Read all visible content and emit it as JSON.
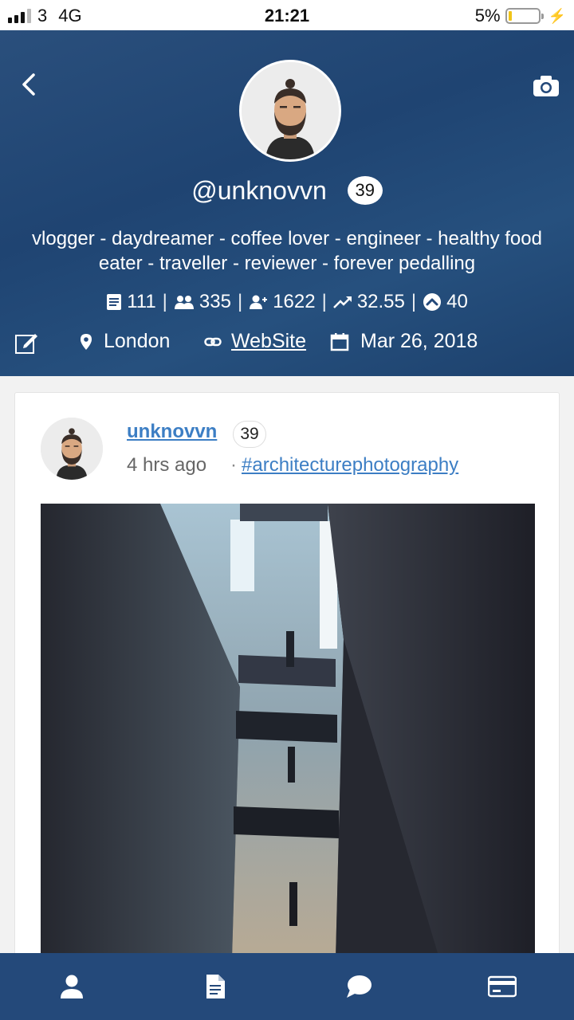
{
  "status_bar": {
    "carrier": "3",
    "network": "4G",
    "time": "21:21",
    "battery": "5%",
    "battery_level": 0.05
  },
  "profile": {
    "username": "@unknovvn",
    "reputation": "39",
    "bio": "vlogger - daydreamer - coffee lover - engineer - healthy food eater - traveller - reviewer - forever pedalling",
    "stats": {
      "posts": "111",
      "followers": "335",
      "following": "1622",
      "steem_power": "32.55",
      "votes": "40"
    },
    "location": "London",
    "website_label": "WebSite",
    "joined": "Mar 26, 2018"
  },
  "post": {
    "author": "unknovvn",
    "reputation": "39",
    "time": "4 hrs ago",
    "separator": "·",
    "tag": "#architecturephotography"
  },
  "icons": {
    "back": "chevron-left-icon",
    "camera": "camera-icon",
    "edit": "edit-icon",
    "location": "map-pin-icon",
    "website": "link-icon",
    "joined": "calendar-icon"
  },
  "colors": {
    "header_bg": "#24497a",
    "link": "#3c7ec4",
    "battery_low": "#f0c419"
  }
}
